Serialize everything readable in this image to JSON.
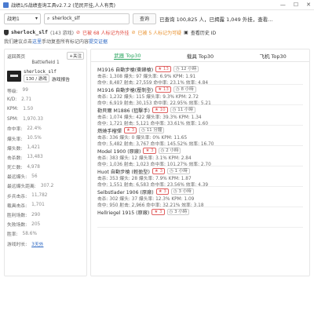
{
  "window": {
    "title": "战绩1/5战绩查询工具v2.7.2 (范民开挂,人人有责)",
    "min": "—",
    "max": "☐",
    "close": "✕"
  },
  "toolbar": {
    "select_value": "战地1",
    "input_value": "sherlock_slf",
    "search_label": "查询",
    "notice": "已查询 100,825 人，已揭露 1,049 外挂，查看..."
  },
  "player": {
    "name": "sherlock_slf",
    "hours": "(143 游戏)",
    "cheat_flag": "已被 68 人标记为外挂",
    "suspicious_flag": "已被 5 人标记为可疑",
    "history": "查看历史 ID"
  },
  "hint": {
    "prefix": "我们建议点击",
    "link1": "这里",
    "middle": "手动复查所有标记内容",
    "link2": "提交证据"
  },
  "left": {
    "back": "返回首页",
    "follow": "关注",
    "game": "Battlefield 1",
    "name": "sherlock_slf",
    "rank": "130 / 游戏",
    "report": "游戏报告",
    "stats": [
      {
        "k": "等级:",
        "v": "99"
      },
      {
        "k": "K/D:",
        "v": "2.71"
      },
      {
        "k": "KPM:",
        "v": "1.50"
      },
      {
        "k": "SPM:",
        "v": "1,970.33"
      },
      {
        "k": "命中率:",
        "v": "22.4%"
      },
      {
        "k": "爆头率:",
        "v": "10.5%"
      },
      {
        "k": "爆头数:",
        "v": "1,421"
      },
      {
        "k": "击杀数:",
        "v": "13,483"
      },
      {
        "k": "死亡数:",
        "v": "4,978"
      },
      {
        "k": "最远爆头:",
        "v": "56"
      },
      {
        "k": "最远爆头距离:",
        "v": "307.2"
      },
      {
        "k": "步兵击杀:",
        "v": "11,782"
      },
      {
        "k": "载具击杀:",
        "v": "1,701"
      },
      {
        "k": "胜利场数:",
        "v": "290"
      },
      {
        "k": "失败场数:",
        "v": "205"
      },
      {
        "k": "胜率:",
        "v": "58.6%"
      },
      {
        "k": "游戏时长:",
        "v": "3天外"
      }
    ]
  },
  "tabs": [
    {
      "label": "武器 Top30"
    },
    {
      "label": "载具 Top30"
    },
    {
      "label": "飞机 Top30"
    }
  ],
  "weapons": [
    {
      "name": "M1916 自動步槍(衝鋒槍)",
      "stars": "13",
      "time": "12 小時",
      "l1": "击杀: 1,308   爆头: 97   爆头率: 6.9%   KPM: 1.91",
      "l2": "命中: 8,487   射击: 27,559   命中率: 23.1%   效率: 4.84"
    },
    {
      "name": "M1916 自動步槍(壓制型)",
      "stars": "13",
      "time": "8 小時",
      "l1": "击杀: 1,232   爆头: 115   爆头率: 9.3%   KPM: 2.72",
      "l2": "命中: 6,919   射击: 30,153   命中率: 22.95%   效率: 5.21"
    },
    {
      "name": "勒貝爾 M1886 (狙擊手)",
      "stars": "10",
      "time": "11 小時",
      "l1": "击杀: 1,074   爆头: 422   爆头率: 39.3%   KPM: 1.34",
      "l2": "命中: 1,721   射击: 5,121   命中率: 33.61%   效率: 1.60"
    },
    {
      "name": "燃燒手榴彈",
      "stars": "3",
      "time": "11 分鐘",
      "l1": "击杀: 336   爆头: 0   爆头率: 0%   KPM: 11.65",
      "l2": "命中: 5,482   射击: 3,767   命中率: 145.52%   效率: 16.70"
    },
    {
      "name": "Model 1900 (原廠)",
      "stars": "3",
      "time": "2 小時",
      "l1": "击杀: 383   爆头: 12   爆头率: 3.1%   KPM: 2.84",
      "l2": "命中: 1,036   射击: 1,023   命中率: 101.27%   效率: 2.70"
    },
    {
      "name": "Huot 自動步槍 (輕盈型)",
      "stars": "3",
      "time": "1 小時",
      "l1": "击杀: 353   爆头: 28   爆头率: 7.9%   KPM: 1.87",
      "l2": "命中: 1,551   射击: 6,583   命中率: 23.56%   效率: 4.39"
    },
    {
      "name": "Selbstlader 1906 (原廠)",
      "stars": "3",
      "time": "3 小時",
      "l1": "击杀: 302   爆头: 37   爆头率: 12.3%   KPM: 1.09",
      "l2": "命中: 950   射击: 2,966   命中率: 32.21%   效率: 3.18"
    },
    {
      "name": "Hellriegel 1915 (原廠)",
      "stars": "3",
      "time": "3 小時",
      "l1": "",
      "l2": ""
    }
  ]
}
